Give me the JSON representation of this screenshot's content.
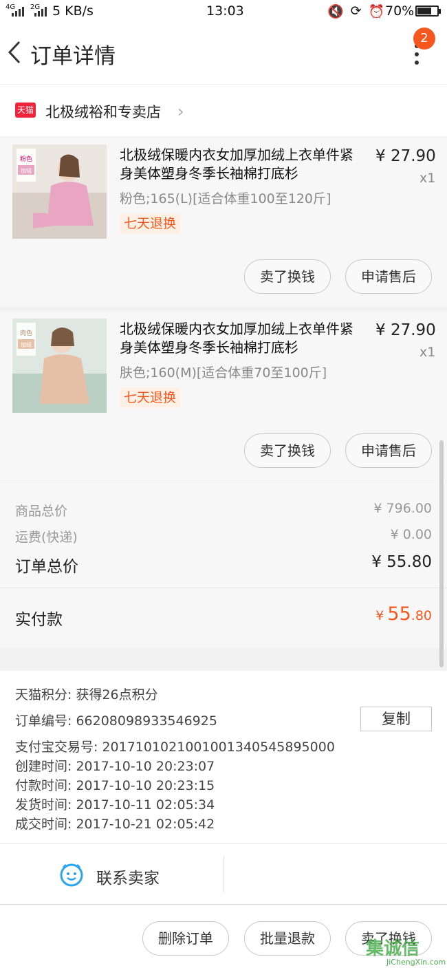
{
  "status_bar": {
    "network": "4G",
    "network2": "2G",
    "speed": "5 KB/s",
    "time": "13:03",
    "battery": "70%",
    "battery_level": 0.7
  },
  "nav": {
    "title": "订单详情",
    "badge": "2"
  },
  "shop": {
    "badge": "天猫",
    "name": "北极绒裕和专卖店"
  },
  "items": [
    {
      "title": "北极绒保暖内衣女加厚加绒上衣单件紧身美体塑身冬季长袖棉打底杉",
      "price": "¥ 27.90",
      "qty": "x1",
      "sku": "粉色;165(L)[适合体重100至120斤]",
      "tag": "七天退换",
      "thumb_label1": "粉色",
      "thumb_label2": "加绒",
      "thumb_color": "#e8a6c3",
      "btn_sell": "卖了换钱",
      "btn_after_sale": "申请售后"
    },
    {
      "title": "北极绒保暖内衣女加厚加绒上衣单件紧身美体塑身冬季长袖棉打底杉",
      "price": "¥ 27.90",
      "qty": "x1",
      "sku": "肤色;160(M)[适合体重70至100斤]",
      "tag": "七天退换",
      "thumb_label1": "肉色",
      "thumb_label2": "加绒",
      "thumb_color": "#e6c0a6",
      "btn_sell": "卖了换钱",
      "btn_after_sale": "申请售后"
    }
  ],
  "prices": {
    "goods_total_label": "商品总价",
    "goods_total": "¥ 796.00",
    "shipping_label": "运费(快递)",
    "shipping": "¥ 0.00",
    "order_total_label": "订单总价",
    "order_total": "¥ 55.80",
    "paid_label": "实付款",
    "paid_symbol": "¥",
    "paid_int": "55",
    "paid_dec": ".80"
  },
  "info": {
    "points": "天猫积分:   获得26点积分",
    "order_no": "订单编号:   66208098933546925",
    "copy_label": "复制",
    "alipay_no": "支付宝交易号:   2017101021001001340545895000",
    "created": "创建时间:   2017-10-10 20:23:07",
    "paid": "付款时间:   2017-10-10 20:23:15",
    "shipped": "发货时间:   2017-10-11 02:05:34",
    "completed": "成交时间:   2017-10-21 02:05:42"
  },
  "contact": {
    "label": "联系卖家"
  },
  "bottom": {
    "delete": "删除订单",
    "refund": "批量退款",
    "sell": "卖了换钱"
  },
  "watermark": {
    "big": "集诚信",
    "small": "JiChengXin.com"
  },
  "colors": {
    "accent": "#f5571e",
    "tmall": "#f0243a"
  }
}
